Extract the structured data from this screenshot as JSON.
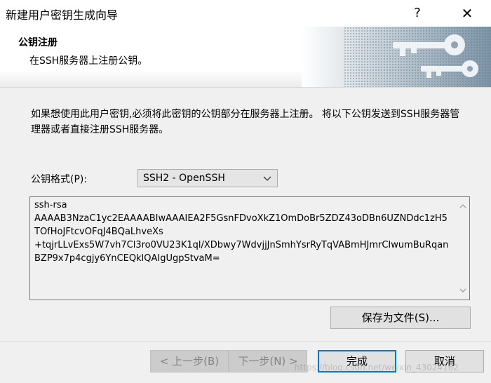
{
  "window": {
    "title": "新建用户密钥生成向导",
    "help_label": "?",
    "close_label": "✕"
  },
  "header": {
    "title": "公钥注册",
    "subtitle": "在SSH服务器上注册公钥。"
  },
  "description": "如果想使用此用户密钥,必须将此密钥的公钥部分在服务器上注册。 将以下公钥发送到SSH服务器管理器或者直接注册SSH服务器。",
  "format": {
    "label": "公钥格式(P):",
    "selected": "SSH2 - OpenSSH"
  },
  "public_key": "ssh-rsa\nAAAAB3NzaC1yc2EAAAABIwAAAIEA2F5GsnFDvoXkZ1OmDoBr5ZDZ43oDBn6UZNDdc1zH5TOfHoJFtcvOFqJ4BQaLhveXs\n+tqjrLLvExs5W7vh7Cl3ro0VU23K1ql/XDbwy7WdvjjJnSmhYsrRyTqVABmHJmrCIwumBuRqanBZP9x7p4cgjy6YnCEQklQAIgUgpStvaM=",
  "buttons": {
    "save": "保存为文件(S)...",
    "prev": "< 上一步(B)",
    "next": "下一步(N) >",
    "finish": "完成",
    "cancel": "取消"
  },
  "watermark": "https://blog.csdn.net/weixin_43024162",
  "colors": {
    "focus_border": "#0078d7",
    "dialog_bg": "#f0f0f0"
  }
}
